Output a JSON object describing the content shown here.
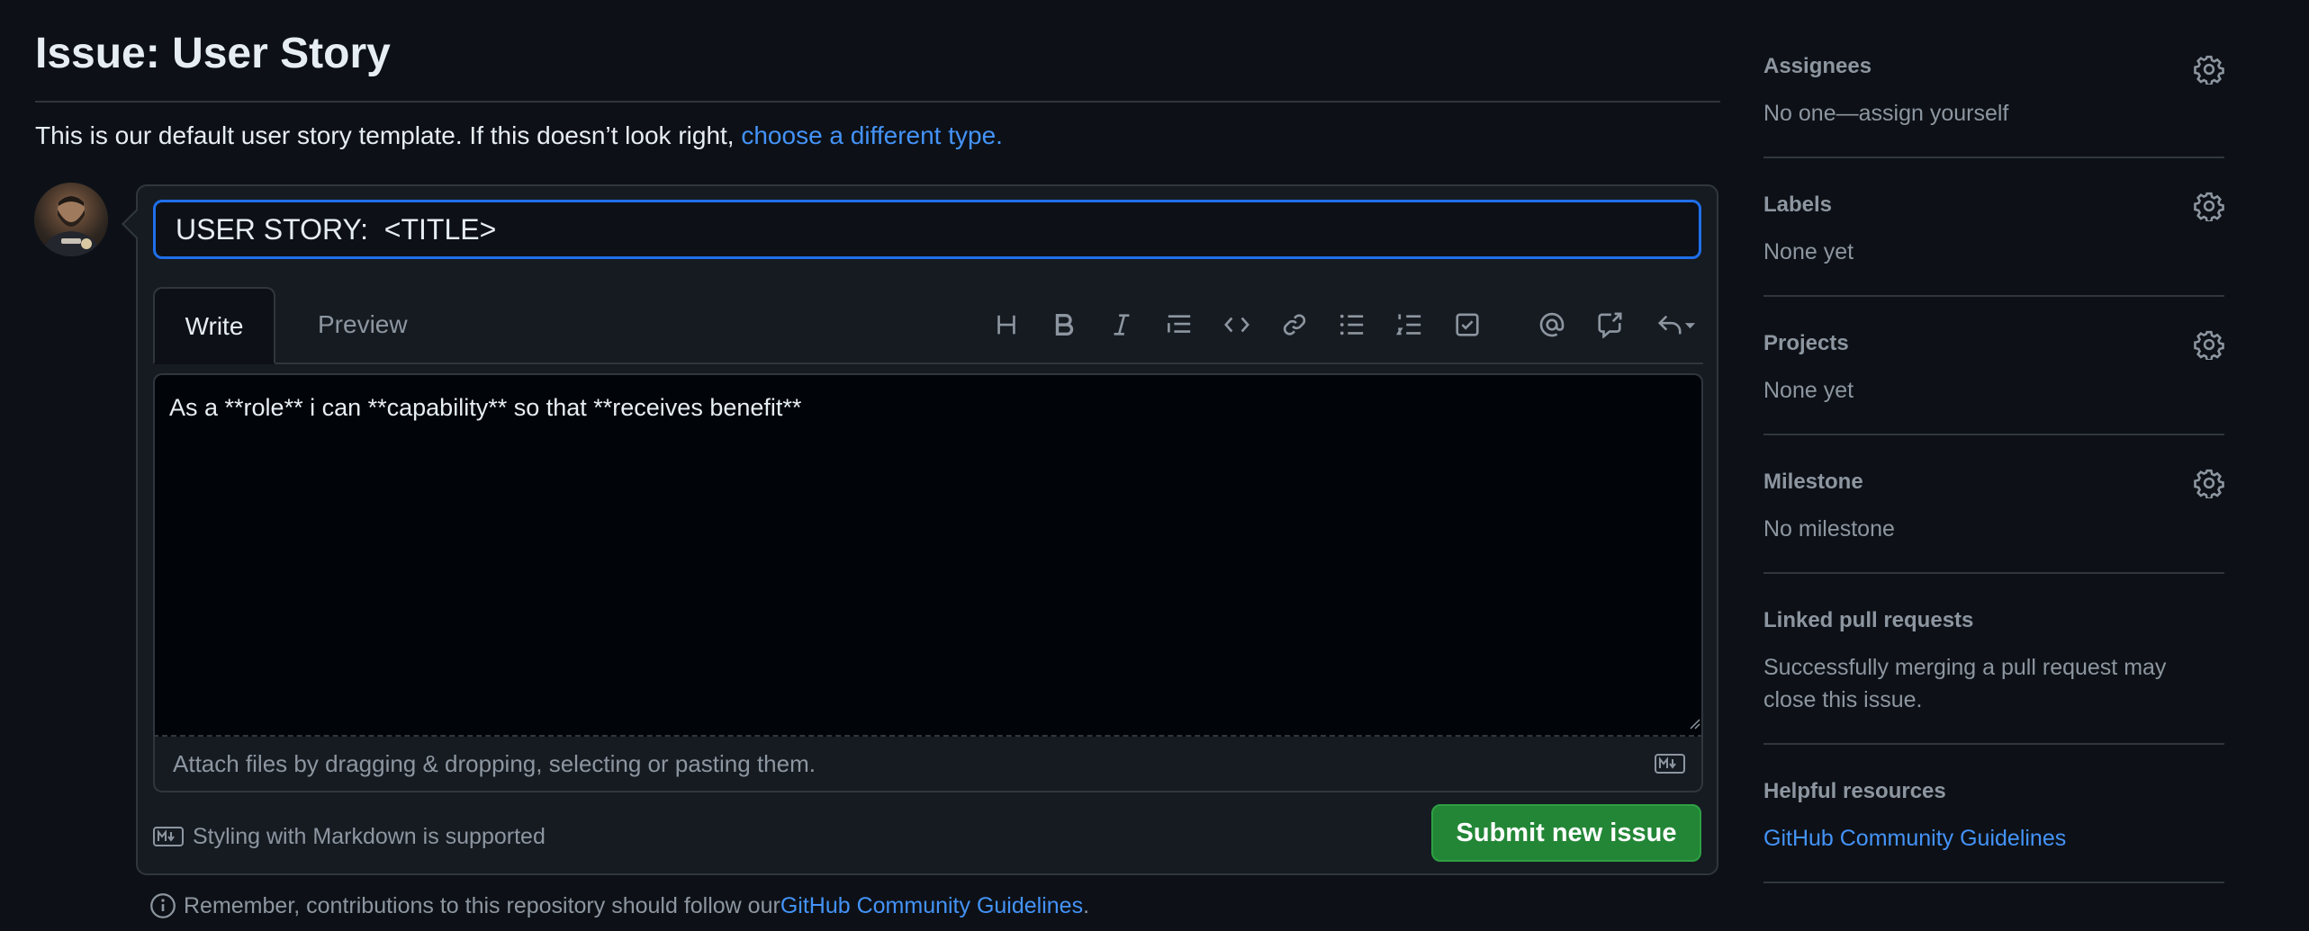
{
  "header": {
    "title": "Issue: User Story",
    "intro_text": "This is our default user story template. If this doesn’t look right, ",
    "intro_link": "choose a different type."
  },
  "composer": {
    "title_value": "USER STORY:  <TITLE>",
    "tabs": [
      {
        "label": "Write",
        "active": true
      },
      {
        "label": "Preview",
        "active": false
      }
    ],
    "toolbar": [
      {
        "icon": "heading-icon"
      },
      {
        "icon": "bold-icon"
      },
      {
        "icon": "italic-icon"
      },
      {
        "icon": "quote-icon"
      },
      {
        "icon": "code-icon"
      },
      {
        "icon": "link-icon"
      },
      {
        "icon": "unordered-list-icon"
      },
      {
        "icon": "ordered-list-icon"
      },
      {
        "icon": "task-list-icon"
      },
      {
        "icon": "mention-icon"
      },
      {
        "icon": "cross-reference-icon"
      },
      {
        "icon": "saved-replies-icon"
      }
    ],
    "body_value": "As a **role** i can **capability** so that **receives benefit**",
    "attach_text": "Attach files by dragging & dropping, selecting or pasting them.",
    "markdown_note": "Styling with Markdown is supported",
    "submit_label": "Submit new issue"
  },
  "footer": {
    "contrib_text": "Remember, contributions to this repository should follow our ",
    "contrib_link": "GitHub Community Guidelines",
    "contrib_end": "."
  },
  "sidebar": {
    "assignees": {
      "heading": "Assignees",
      "value": "No one—assign yourself"
    },
    "labels": {
      "heading": "Labels",
      "value": "None yet"
    },
    "projects": {
      "heading": "Projects",
      "value": "None yet"
    },
    "milestone": {
      "heading": "Milestone",
      "value": "No milestone"
    },
    "linked_prs": {
      "heading": "Linked pull requests",
      "value_line1": "Successfully merging a pull request may",
      "value_line2": "close this issue."
    },
    "helpful": {
      "heading": "Helpful resources",
      "link": "GitHub Community Guidelines"
    }
  },
  "colors": {
    "background": "#0d1117",
    "accent_link": "#4493f8",
    "focus_border": "#1f6feb",
    "submit_green": "#238636",
    "muted_text": "#8d96a0"
  }
}
